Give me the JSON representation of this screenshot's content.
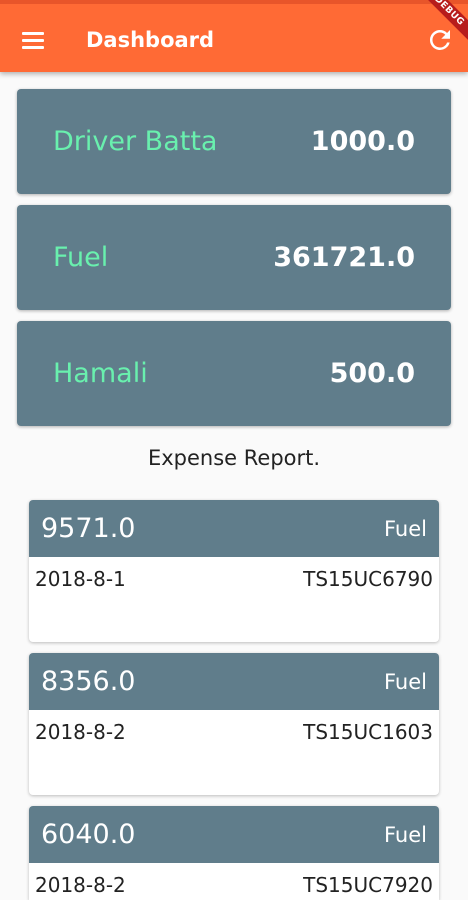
{
  "appbar": {
    "title": "Dashboard",
    "menu_icon": "hamburger-menu-icon",
    "refresh_icon": "refresh-icon",
    "debug_banner": "DEBUG",
    "color": "#ff6a35"
  },
  "summary": [
    {
      "label": "Driver Batta",
      "value": "1000.0"
    },
    {
      "label": "Fuel",
      "value": "361721.0"
    },
    {
      "label": "Hamali",
      "value": "500.0"
    }
  ],
  "report": {
    "heading": "Expense Report.",
    "items": [
      {
        "amount": "9571.0",
        "type": "Fuel",
        "date": "2018-8-1",
        "vehicle": "TS15UC6790"
      },
      {
        "amount": "8356.0",
        "type": "Fuel",
        "date": "2018-8-2",
        "vehicle": "TS15UC1603"
      },
      {
        "amount": "6040.0",
        "type": "Fuel",
        "date": "2018-8-2",
        "vehicle": "TS15UC7920"
      }
    ]
  },
  "colors": {
    "card": "#607d8b",
    "label_accent": "#69f0ae"
  }
}
